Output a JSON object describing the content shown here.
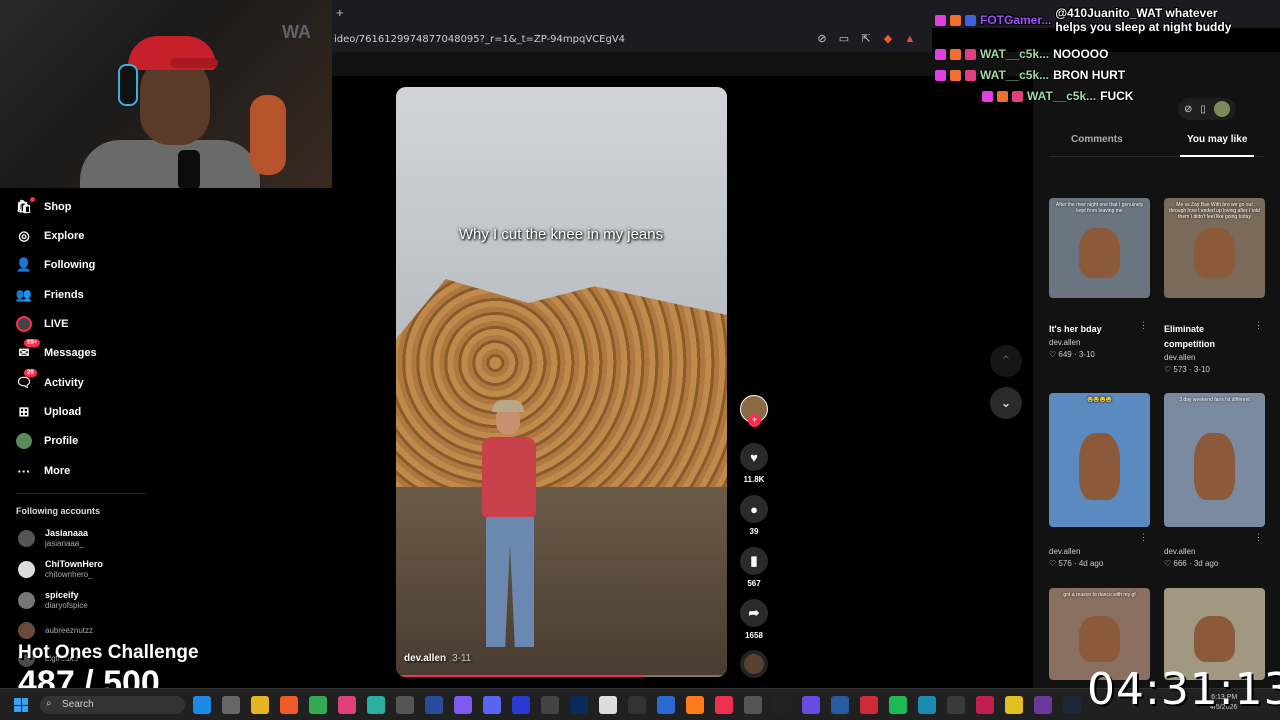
{
  "browser": {
    "new_tab": "+",
    "url": "ideo/7616129974877048095?_r=1&_t=ZP-94mpqVCEgV4"
  },
  "webcam": {
    "watermark": "WA"
  },
  "sidebar": {
    "items": [
      {
        "label": "Shop",
        "icon": "shop-bag-icon",
        "glyph": "🛍"
      },
      {
        "label": "Explore",
        "icon": "compass-icon",
        "glyph": "◎"
      },
      {
        "label": "Following",
        "icon": "following-person-icon",
        "glyph": "👤"
      },
      {
        "label": "Friends",
        "icon": "friends-icon",
        "glyph": "👥"
      },
      {
        "label": "LIVE",
        "icon": "live-icon",
        "glyph": ""
      },
      {
        "label": "Messages",
        "icon": "messages-icon",
        "glyph": "✉",
        "badge": "99+"
      },
      {
        "label": "Activity",
        "icon": "activity-icon",
        "glyph": "🗨",
        "badge": "29"
      },
      {
        "label": "Upload",
        "icon": "upload-icon",
        "glyph": "⊞"
      },
      {
        "label": "Profile",
        "icon": "profile-avatar-icon",
        "glyph": ""
      },
      {
        "label": "More",
        "icon": "more-dots-icon",
        "glyph": "···"
      }
    ],
    "following_title": "Following accounts",
    "accounts": [
      {
        "name": "Jasianaaa",
        "handle": "jasianaaa_"
      },
      {
        "name": "ChiTownHero",
        "handle": "chitownhero_"
      },
      {
        "name": "spiceify",
        "handle": "diaryofspice"
      },
      {
        "name": "",
        "handle": "aubreeznutzz"
      },
      {
        "name": "",
        "handle": "bigfreako"
      }
    ]
  },
  "overlay": {
    "challenge": "Hot Ones Challenge",
    "counter": "487 / 500",
    "clock": "04:31:13"
  },
  "video": {
    "caption": "Why I cut the knee in my jeans",
    "author": "dev.allen",
    "ago": "3-11",
    "progress": 0.75
  },
  "actions": {
    "likes": "11.8K",
    "comments": "39",
    "saves": "567",
    "shares": "1658"
  },
  "right_panel": {
    "tabs": [
      "Comments",
      "You may like"
    ],
    "cards": [
      {
        "title": "It's her bday",
        "author": "dev.allen",
        "stats": "♡ 649 · 3-10",
        "thumb_text": "After the river night one that I genuinely kept from leaving me",
        "bg": "#6a7580"
      },
      {
        "title": "Eliminate competition",
        "author": "dev.allen",
        "stats": "♡ 573 · 3-10",
        "thumb_text": "Me vs Zay Bae With bro we go out through how I ended up loving after I told them I didn't feel like going today",
        "bg": "#7a6a5a"
      },
      {
        "title": "",
        "author": "dev.allen",
        "stats": "♡ 576 · 4d ago",
        "thumb_text": "😭😭😭😭",
        "bg": "#5a8ac0"
      },
      {
        "title": "",
        "author": "dev.allen",
        "stats": "♡ 666 · 3d ago",
        "thumb_text": "3 day weekend fans hit different",
        "bg": "#7a8aa0"
      },
      {
        "title": "",
        "author": "",
        "stats": "",
        "thumb_text": "got a reason to dance with my gf",
        "bg": "#8a7060"
      },
      {
        "title": "",
        "author": "",
        "stats": "",
        "thumb_text": "",
        "bg": "#a09880"
      }
    ]
  },
  "chat": [
    {
      "user": "FOTGamer...",
      "msg": "@410Juanito_WAT whatever helps you sleep at night buddy",
      "color": "#a050ff"
    },
    {
      "user": "WAT__c5k...",
      "msg": "NOOOOO",
      "color": "#a0d8a8"
    },
    {
      "user": "WAT__c5k...",
      "msg": "BRON HURT",
      "color": "#a0d8a8"
    },
    {
      "user": "WAT__c5k...",
      "msg": "FUCK",
      "color": "#a0d8a8"
    }
  ],
  "taskbar": {
    "search": "Search",
    "time": "6:13 PM",
    "date": "4/5/2026"
  }
}
